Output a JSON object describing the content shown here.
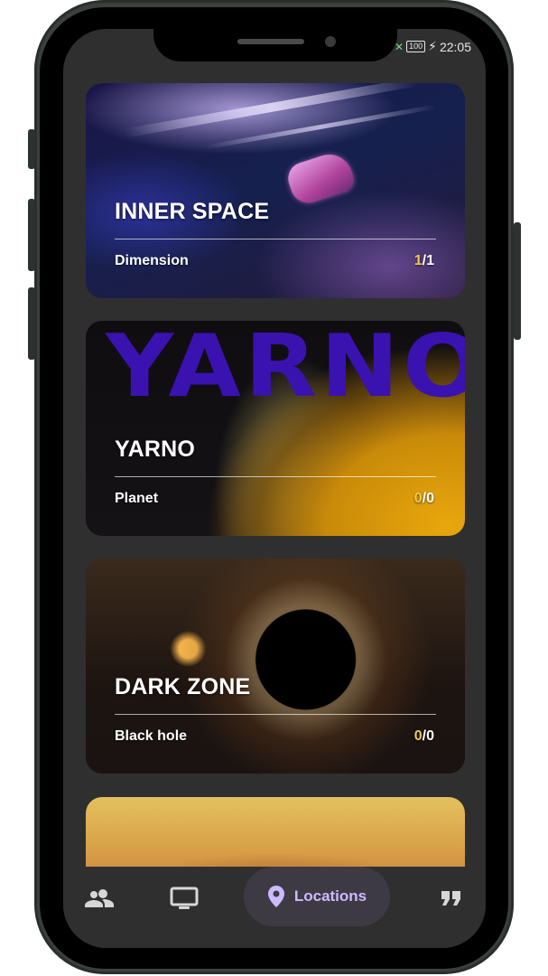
{
  "status_bar": {
    "battery": "100",
    "time": "22:05"
  },
  "cards": [
    {
      "title": "INNER SPACE",
      "kind": "Dimension",
      "count_done": "1",
      "count_total": "/1"
    },
    {
      "title": "YARNO",
      "banner": "YARNO",
      "kind": "Planet",
      "count_done": "0",
      "count_total": "/0"
    },
    {
      "title": "DARK ZONE",
      "kind": "Black hole",
      "count_done": "0",
      "count_total": "/0"
    }
  ],
  "bottom_nav": {
    "items": [
      {
        "icon": "people-icon"
      },
      {
        "icon": "tv-icon"
      },
      {
        "icon": "location-pin-icon",
        "label": "Locations",
        "active": true
      },
      {
        "icon": "quote-icon"
      }
    ]
  },
  "colors": {
    "accent": "#cdb9ff",
    "count_highlight": "#f2c94c",
    "background": "#2f2f30"
  }
}
